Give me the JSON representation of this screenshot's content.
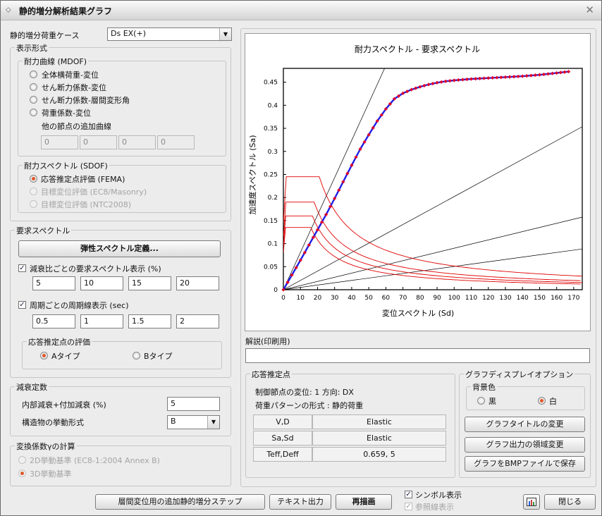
{
  "window": {
    "title": "静的増分解析結果グラフ"
  },
  "load_case": {
    "label": "静的増分荷重ケース",
    "value": "Ds EX(+)"
  },
  "display_format": {
    "legend": "表示形式",
    "capacity_mdof": {
      "legend": "耐力曲線 (MDOF)",
      "options": [
        "全体横荷重-変位",
        "せん断力係数-変位",
        "せん断力係数-層間変形角",
        "荷重係数-変位"
      ],
      "extra_label": "他の節点の追加曲線",
      "extra_values": [
        "0",
        "0",
        "0",
        "0"
      ]
    },
    "capacity_sdof": {
      "legend": "耐力スペクトル (SDOF)",
      "options": [
        "応答推定点評価 (FEMA)",
        "目標変位評価 (EC8/Masonry)",
        "目標変位評価 (NTC2008)"
      ]
    }
  },
  "demand": {
    "legend": "要求スペクトル",
    "define_button": "弾性スペクトル定義...",
    "damping_check": "減衰比ごとの要求スペクトル表示 (%)",
    "damping_values": [
      "5",
      "10",
      "15",
      "20"
    ],
    "period_check": "周期ごとの周期線表示 (sec)",
    "period_values": [
      "0.5",
      "1",
      "1.5",
      "2"
    ],
    "eval": {
      "legend": "応答推定点の評価",
      "type_a": "Aタイプ",
      "type_b": "Bタイプ"
    }
  },
  "damping": {
    "legend": "減衰定数",
    "internal_label": "内部減衰+付加減衰 (%)",
    "internal_value": "5",
    "behavior_label": "構造物の挙動形式",
    "behavior_value": "B"
  },
  "conversion": {
    "legend": "変換係数γの計算",
    "opt1": "2D挙動基準 (EC8-1:2004  Annex B)",
    "opt2": "3D挙動基準"
  },
  "explanation": {
    "label": "解説(印刷用)",
    "value": ""
  },
  "response_point": {
    "legend": "応答推定点",
    "line1": "制御節点の変位: 1  方向: DX",
    "line2": "荷重パターンの形式 : 静的荷重",
    "rows": [
      {
        "k": "V,D",
        "v": "Elastic"
      },
      {
        "k": "Sa,Sd",
        "v": "Elastic"
      },
      {
        "k": "Teff,Deff",
        "v": "0.659,       5"
      }
    ]
  },
  "graph_options": {
    "legend": "グラフディスプレイオプション",
    "bg_legend": "背景色",
    "black": "黒",
    "white": "白",
    "btn_title": "グラフタイトルの変更",
    "btn_area": "グラフ出力の領域変更",
    "btn_bmp": "グラフをBMPファイルで保存"
  },
  "bottom": {
    "btn_story": "層間変位用の追加静的増分ステップ",
    "btn_text": "テキスト出力",
    "btn_redraw": "再描画",
    "chk_symbol": "シンボル表示",
    "chk_ref": "参照線表示",
    "btn_close": "閉じる"
  },
  "colors": {
    "capacity_line": "#1e1ee6",
    "capacity_marker": "#e0002a",
    "demand": "#e00000",
    "period": "#000000"
  },
  "chart_data": {
    "type": "line",
    "title": "耐力スペクトル - 要求スペクトル",
    "xlabel": "変位スペクトル (Sd)",
    "ylabel": "加速度スペクトル (Sa)",
    "xlim": [
      0,
      175
    ],
    "ylim": [
      0,
      0.48
    ],
    "xticks": [
      "0",
      "10",
      "20",
      "30",
      "40",
      "50",
      "60",
      "70",
      "80",
      "90",
      "100",
      "110",
      "120",
      "130",
      "140",
      "150",
      "160",
      "170"
    ],
    "yticks": [
      "0",
      "0.05",
      "0.1",
      "0.15",
      "0.2",
      "0.25",
      "0.3",
      "0.35",
      "0.4",
      "0.45"
    ],
    "capacity": {
      "x": [
        0,
        5,
        10,
        15,
        20,
        25,
        30,
        35,
        40,
        45,
        50,
        55,
        60,
        65,
        70,
        75,
        80,
        85,
        90,
        95,
        100,
        110,
        120,
        130,
        140,
        150,
        160,
        167
      ],
      "y": [
        0,
        0.032,
        0.064,
        0.097,
        0.13,
        0.163,
        0.198,
        0.234,
        0.27,
        0.305,
        0.336,
        0.366,
        0.392,
        0.414,
        0.426,
        0.434,
        0.44,
        0.445,
        0.449,
        0.452,
        0.454,
        0.457,
        0.459,
        0.461,
        0.463,
        0.466,
        0.47,
        0.473
      ]
    },
    "demand_series": [
      {
        "plateau": 0.245,
        "corner_sd": 21
      },
      {
        "plateau": 0.19,
        "corner_sd": 18
      },
      {
        "plateau": 0.16,
        "corner_sd": 17
      },
      {
        "plateau": 0.135,
        "corner_sd": 16
      }
    ],
    "period_lines": [
      {
        "T": 0.5,
        "slope": 0.0081
      },
      {
        "T": 1,
        "slope": 0.00202
      },
      {
        "T": 1.5,
        "slope": 0.0009
      },
      {
        "T": 2,
        "slope": 0.000505
      }
    ]
  }
}
